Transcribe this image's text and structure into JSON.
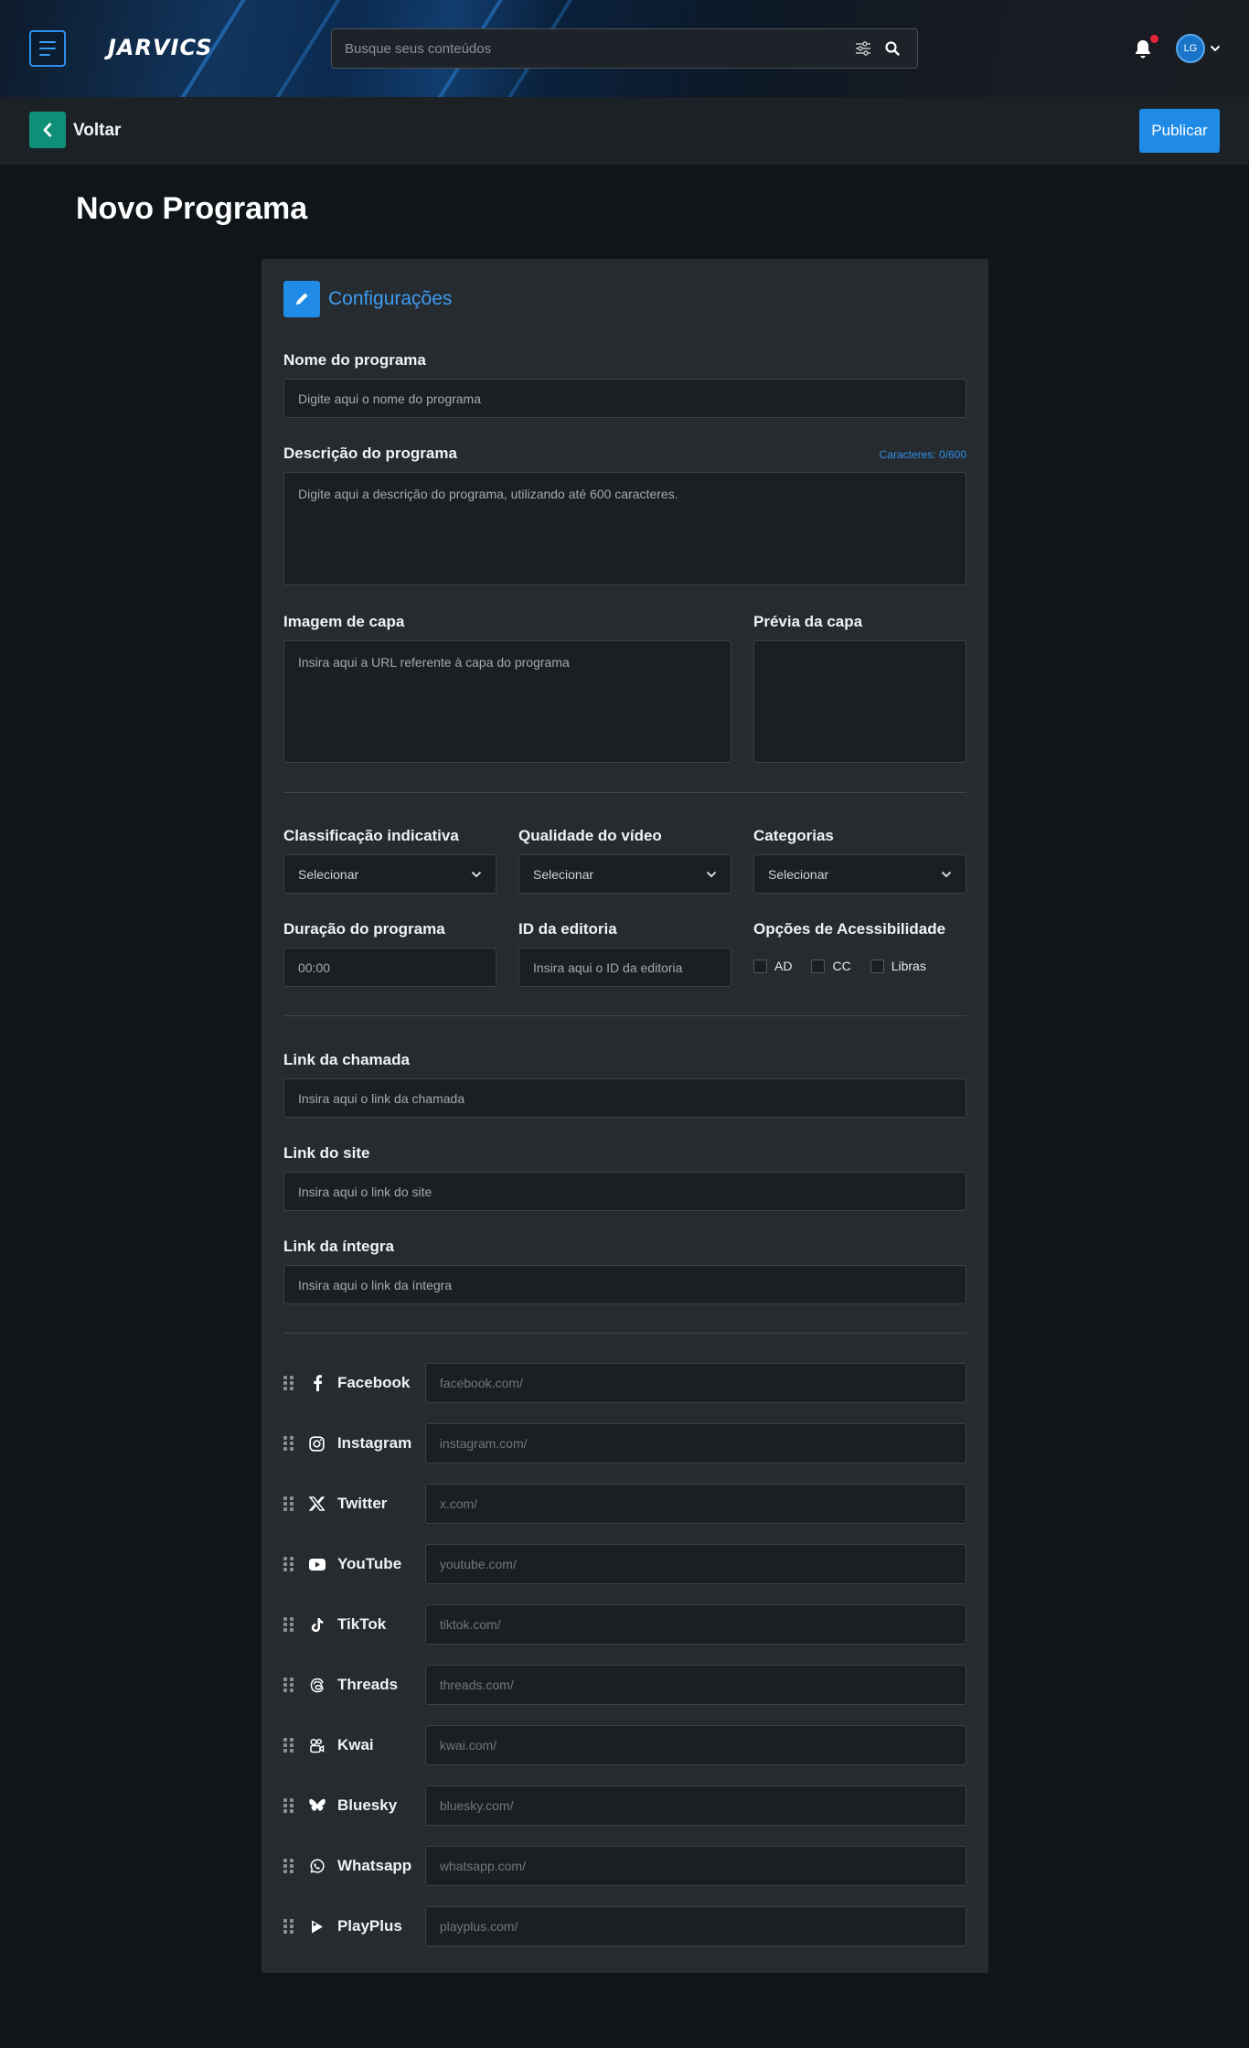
{
  "header": {
    "logo": "JARVICS",
    "search_placeholder": "Busque seus conteúdos",
    "avatar_initials": "LG"
  },
  "subbar": {
    "back_label": "Voltar",
    "publish_label": "Publicar"
  },
  "page_title": "Novo Programa",
  "card": {
    "title": "Configurações",
    "nome": {
      "label": "Nome do programa",
      "placeholder": "Digite aqui o nome do programa"
    },
    "descricao": {
      "label": "Descrição do programa",
      "counter": "Caracteres: 0/600",
      "placeholder": "Digite aqui a descrição do programa, utilizando até 600 caracteres."
    },
    "imagem": {
      "label": "Imagem de capa",
      "placeholder": "Insira aqui a URL referente à capa do programa"
    },
    "previa": {
      "label": "Prévia da capa"
    },
    "classificacao": {
      "label": "Classificação indicativa",
      "value": "Selecionar"
    },
    "qualidade": {
      "label": "Qualidade do vídeo",
      "value": "Selecionar"
    },
    "categorias": {
      "label": "Categorias",
      "value": "Selecionar"
    },
    "duracao": {
      "label": "Duração do programa",
      "placeholder": "00:00"
    },
    "editoria": {
      "label": "ID da editoria",
      "placeholder": "Insira aqui o ID da editoria"
    },
    "acessibilidade": {
      "label": "Opções de Acessibilidade",
      "options": [
        "AD",
        "CC",
        "Libras"
      ]
    },
    "link_chamada": {
      "label": "Link da chamada",
      "placeholder": "Insira aqui o link da chamada"
    },
    "link_site": {
      "label": "Link do site",
      "placeholder": "Insira aqui o link do site"
    },
    "link_integra": {
      "label": "Link da íntegra",
      "placeholder": "Insira aqui o link da íntegra"
    },
    "social": [
      {
        "name": "Facebook",
        "placeholder": "facebook.com/",
        "icon": "facebook-icon"
      },
      {
        "name": "Instagram",
        "placeholder": "instagram.com/",
        "icon": "instagram-icon"
      },
      {
        "name": "Twitter",
        "placeholder": "x.com/",
        "icon": "x-icon"
      },
      {
        "name": "YouTube",
        "placeholder": "youtube.com/",
        "icon": "youtube-icon"
      },
      {
        "name": "TikTok",
        "placeholder": "tiktok.com/",
        "icon": "tiktok-icon"
      },
      {
        "name": "Threads",
        "placeholder": "threads.com/",
        "icon": "threads-icon"
      },
      {
        "name": "Kwai",
        "placeholder": "kwai.com/",
        "icon": "kwai-icon"
      },
      {
        "name": "Bluesky",
        "placeholder": "bluesky.com/",
        "icon": "bluesky-icon"
      },
      {
        "name": "Whatsapp",
        "placeholder": "whatsapp.com/",
        "icon": "whatsapp-icon"
      },
      {
        "name": "PlayPlus",
        "placeholder": "playplus.com/",
        "icon": "playplus-icon"
      }
    ]
  },
  "colors": {
    "accent": "#1f8be6",
    "back_button": "#0f8f78",
    "notification_dot": "#e5263a",
    "page_bg": "#0f1519",
    "card_bg": "#262b30"
  }
}
